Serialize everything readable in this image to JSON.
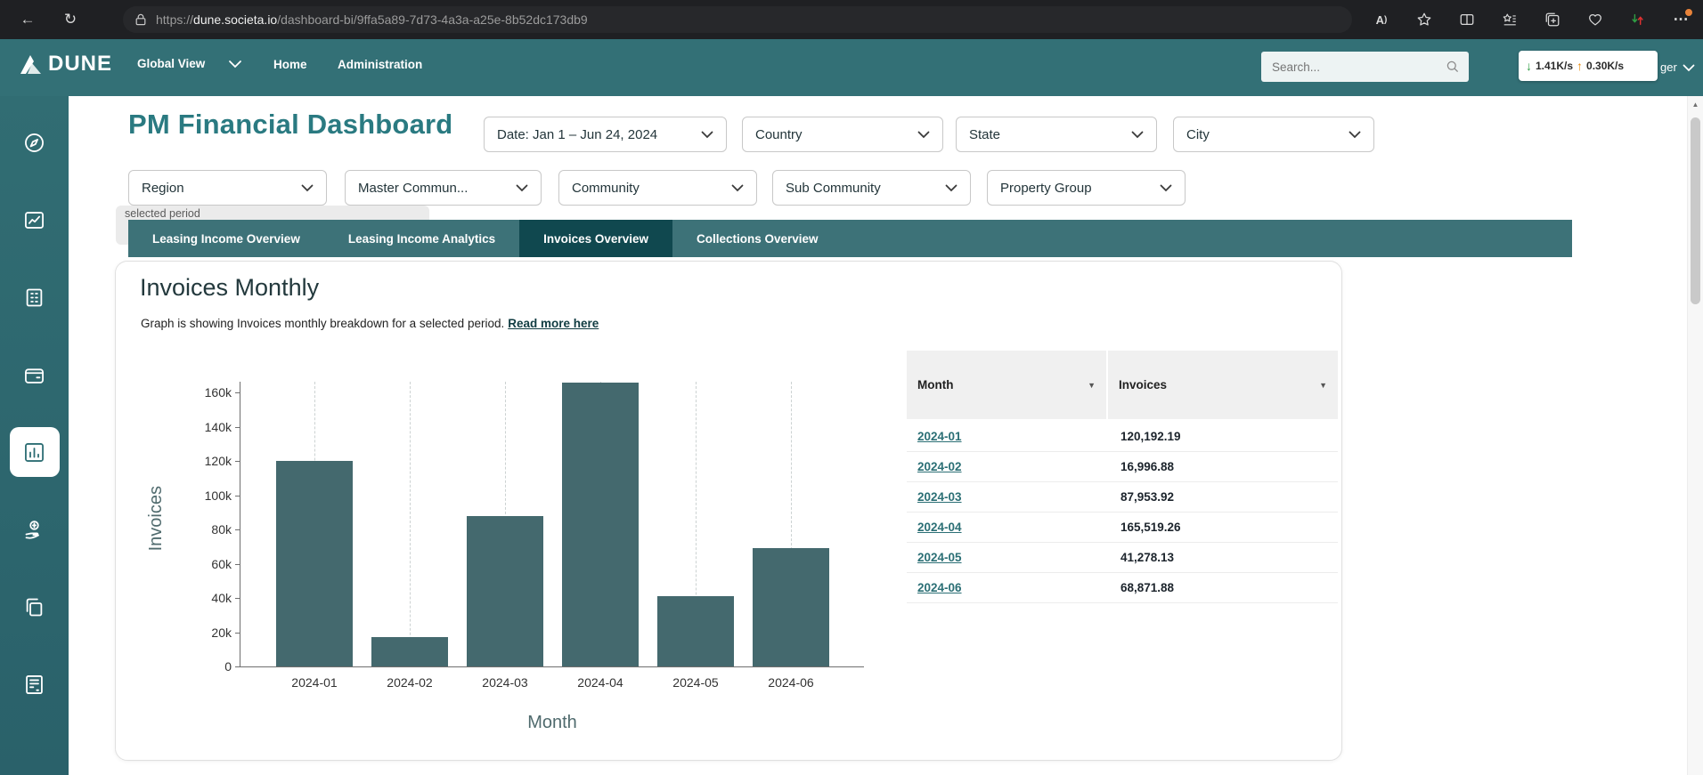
{
  "browser": {
    "url_scheme": "https://",
    "url_domain": "dune.societa.io",
    "url_path": "/dashboard-bi/9ffa5a89-7d73-4a3a-a25e-8b52dc173db9"
  },
  "header": {
    "logo_text": "DUNE",
    "view_selector": "Global View",
    "nav": [
      "Home",
      "Administration"
    ],
    "search_placeholder": "Search...",
    "net_down": "1.41K/s",
    "net_up": "0.30K/s",
    "user_partial": "ger"
  },
  "sidebar": {
    "items": [
      {
        "icon": "compass-icon",
        "active": false
      },
      {
        "icon": "report-chart-icon",
        "active": false
      },
      {
        "icon": "building-icon",
        "active": false
      },
      {
        "icon": "wallet-icon",
        "active": false
      },
      {
        "icon": "analytics-icon",
        "active": true
      },
      {
        "icon": "hand-payment-icon",
        "active": false
      },
      {
        "icon": "copy-stack-icon",
        "active": false
      },
      {
        "icon": "ledger-building-icon",
        "active": false
      }
    ]
  },
  "page": {
    "title": "PM Financial Dashboard",
    "tooltip_fragment": "selected period"
  },
  "filters": {
    "row1": [
      "Date: Jan 1 – Jun 24, 2024",
      "Country",
      "State",
      "City"
    ],
    "row2": [
      "Region",
      "Master Commun...",
      "Community",
      "Sub Community",
      "Property Group"
    ]
  },
  "tabs": [
    {
      "label": "Leasing Income Overview",
      "active": false
    },
    {
      "label": "Leasing Income Analytics",
      "active": false
    },
    {
      "label": "Invoices Overview",
      "active": true
    },
    {
      "label": "Collections Overview",
      "active": false
    }
  ],
  "card": {
    "title": "Invoices Monthly",
    "subtitle": "Graph is showing Invoices monthly breakdown for a selected period.",
    "read_more": "Read more here"
  },
  "chart_data": {
    "type": "bar",
    "categories": [
      "2024-01",
      "2024-02",
      "2024-03",
      "2024-04",
      "2024-05",
      "2024-06"
    ],
    "values": [
      120192.19,
      16996.88,
      87953.92,
      165519.26,
      41278.13,
      68871.88
    ],
    "title": "Invoices Monthly",
    "xlabel": "Month",
    "ylabel": "Invoices",
    "ylim": [
      0,
      170000
    ],
    "yticks": [
      0,
      20000,
      40000,
      60000,
      80000,
      100000,
      120000,
      140000,
      160000
    ],
    "ytick_labels": [
      "0",
      "20k",
      "40k",
      "60k",
      "80k",
      "100k",
      "120k",
      "140k",
      "160k"
    ],
    "bar_color": "#44696e",
    "grid": "vertical-dashed",
    "legend": "none"
  },
  "table": {
    "columns": [
      "Month",
      "Invoices"
    ],
    "rows": [
      {
        "month": "2024-01",
        "invoices": "120,192.19"
      },
      {
        "month": "2024-02",
        "invoices": "16,996.88"
      },
      {
        "month": "2024-03",
        "invoices": "87,953.92"
      },
      {
        "month": "2024-04",
        "invoices": "165,519.26"
      },
      {
        "month": "2024-05",
        "invoices": "41,278.13"
      },
      {
        "month": "2024-06",
        "invoices": "68,871.88"
      }
    ]
  },
  "colors": {
    "header_teal": "#337076",
    "tab_bar": "#3d7278",
    "tab_active": "#10484f",
    "bar": "#44696e",
    "link": "#2b6f75",
    "title": "#2a7a81"
  }
}
